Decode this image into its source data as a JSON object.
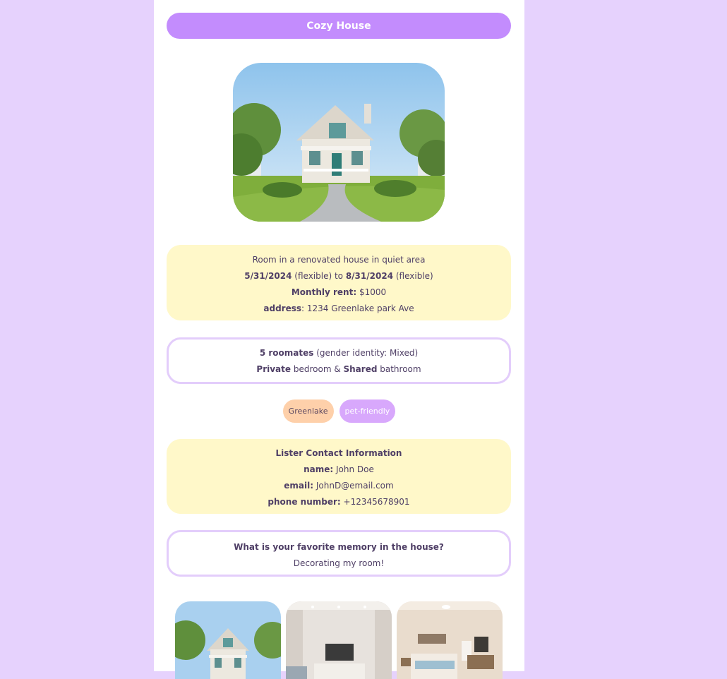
{
  "listing": {
    "title": "Cozy House",
    "hero_image": "house-photo"
  },
  "summary": {
    "description": "Room in a renovated house in quiet area",
    "start_date": "5/31/2024",
    "start_note": " (flexible) to ",
    "end_date": "8/31/2024",
    "end_note": " (flexible)",
    "rent_label": "Monthly rent:",
    "rent_value": " $1000",
    "address_label": "address",
    "address_value": ": 1234 Greenlake park Ave"
  },
  "roommates": {
    "count_label": "5 roomates",
    "gender_text": " (gender identity: Mixed)",
    "bedroom_label": "Private",
    "bedroom_text": " bedroom & ",
    "bathroom_label": "Shared",
    "bathroom_text": " bathroom"
  },
  "tags": [
    "Greenlake",
    "pet-friendly"
  ],
  "contact": {
    "heading": "Lister Contact Information",
    "name_label": "name:",
    "name_value": " John Doe",
    "email_label": "email:",
    "email_value": " JohnD@email.com",
    "phone_label": "phone number:",
    "phone_value": " +12345678901"
  },
  "memory": {
    "question": "What is your favorite memory in the house?",
    "answer": "Decorating my room!"
  },
  "gallery": [
    "house-exterior-photo",
    "living-room-photo",
    "bedroom-photo"
  ],
  "colors": {
    "background": "#e6d2fd",
    "title_pill": "#c38cfd",
    "yellow_card": "#fff8c9",
    "card_border": "#e3cdfb",
    "tag_peach": "#fed0aa",
    "tag_purple": "#d8a8fc"
  }
}
